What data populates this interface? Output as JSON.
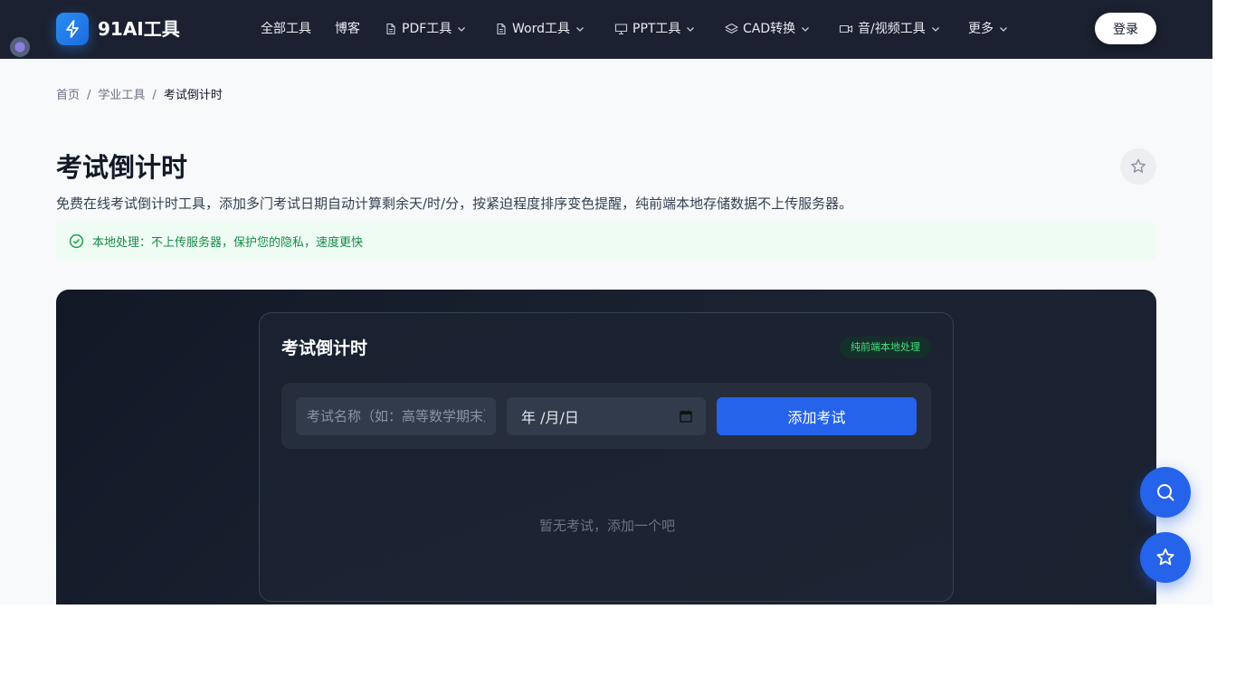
{
  "app": {
    "logo_text": "91AI工具",
    "logo_icon": "lightning-icon"
  },
  "nav": {
    "all_tools": "全部工具",
    "blog": "博客",
    "pdf": "PDF工具",
    "word": "Word工具",
    "ppt": "PPT工具",
    "cad": "CAD转换",
    "media": "音/视频工具",
    "more": "更多",
    "login": "登录"
  },
  "breadcrumb": {
    "home": "首页",
    "sep": "/",
    "category": "学业工具",
    "current": "考试倒计时"
  },
  "page": {
    "title": "考试倒计时",
    "description": "免费在线考试倒计时工具，添加多门考试日期自动计算剩余天/时/分，按紧迫程度排序变色提醒，纯前端本地存储数据不上传服务器。",
    "notice": "本地处理：不上传服务器，保护您的隐私，速度更快"
  },
  "tool": {
    "card_title": "考试倒计时",
    "badge": "纯前端本地处理",
    "name_placeholder": "考试名称（如：高等数学期末）",
    "date_value": "年 /月/日",
    "add_button": "添加考试",
    "empty": "暂无考试，添加一个吧"
  },
  "colors": {
    "navbar": "#1b2130",
    "accent": "#2563eb",
    "success": "#168a45"
  }
}
